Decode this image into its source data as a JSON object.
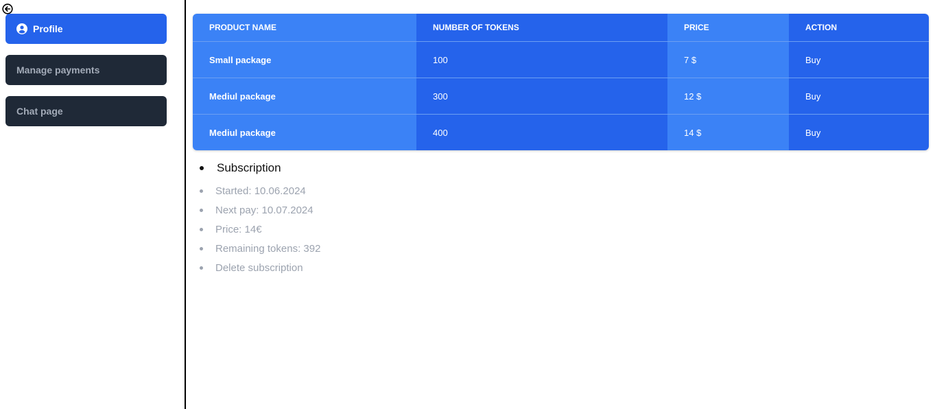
{
  "icons": {
    "back": "arrow-left-circle-icon",
    "profile": "user-circle-icon"
  },
  "colors": {
    "primary": "#2563eb",
    "primary_light": "#3b82f6",
    "sidebar_dark": "#1f2937",
    "muted_text": "#9ca3af"
  },
  "sidebar": {
    "items": [
      {
        "label": "Profile",
        "active": true
      },
      {
        "label": "Manage payments",
        "active": false
      },
      {
        "label": "Chat page",
        "active": false
      }
    ]
  },
  "products_table": {
    "headers": [
      "PRODUCT NAME",
      "NUMBER OF TOKENS",
      "PRICE",
      "ACTION"
    ],
    "rows": [
      {
        "name": "Small package",
        "tokens": "100",
        "price": "7 $",
        "action": "Buy"
      },
      {
        "name": "Mediul package",
        "tokens": "300",
        "price": "12 $",
        "action": "Buy"
      },
      {
        "name": "Mediul package",
        "tokens": "400",
        "price": "14 $",
        "action": "Buy"
      }
    ]
  },
  "subscription": {
    "title": "Subscription",
    "started": "Started: 10.06.2024",
    "next_pay": "Next pay: 10.07.2024",
    "price": "Price: 14€",
    "remaining_tokens": "Remaining tokens: 392",
    "delete_label": "Delete subscription"
  }
}
